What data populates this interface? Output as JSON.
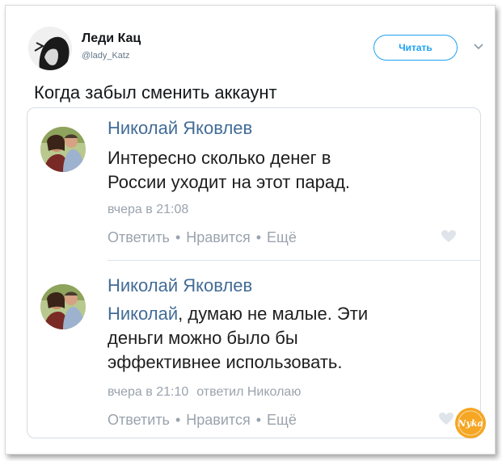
{
  "tweet": {
    "author_name": "Леди Кац",
    "author_handle": "@lady_Katz",
    "follow_label": "Читать",
    "text": "Когда забыл сменить аккаунт"
  },
  "comments": [
    {
      "author": "Николай Яковлев",
      "mention": "",
      "text_lines": [
        "Интересно сколько денег в",
        "России уходит на этот парад."
      ],
      "time": "вчера в 21:08",
      "reply_to": "",
      "actions": {
        "reply": "Ответить",
        "like": "Нравится",
        "more": "Ещё"
      }
    },
    {
      "author": "Николай Яковлев",
      "mention": "Николай",
      "text_first_rest": ", думаю не малые. Эти",
      "text_lines": [
        "деньги можно было бы",
        "эффективнее использовать."
      ],
      "time": "вчера в 21:10",
      "reply_to": "ответил Николаю",
      "actions": {
        "reply": "Ответить",
        "like": "Нравится",
        "more": "Ещё"
      }
    }
  ],
  "watermark": {
    "text": "Nyka"
  },
  "colors": {
    "twitter_blue": "#1da1f2",
    "vk_link": "#426c96",
    "meta_gray": "#9aa3ad",
    "badge_orange": "#f5a623"
  },
  "icons": [
    "chevron-down-icon",
    "heart-icon",
    "watermark-badge"
  ]
}
